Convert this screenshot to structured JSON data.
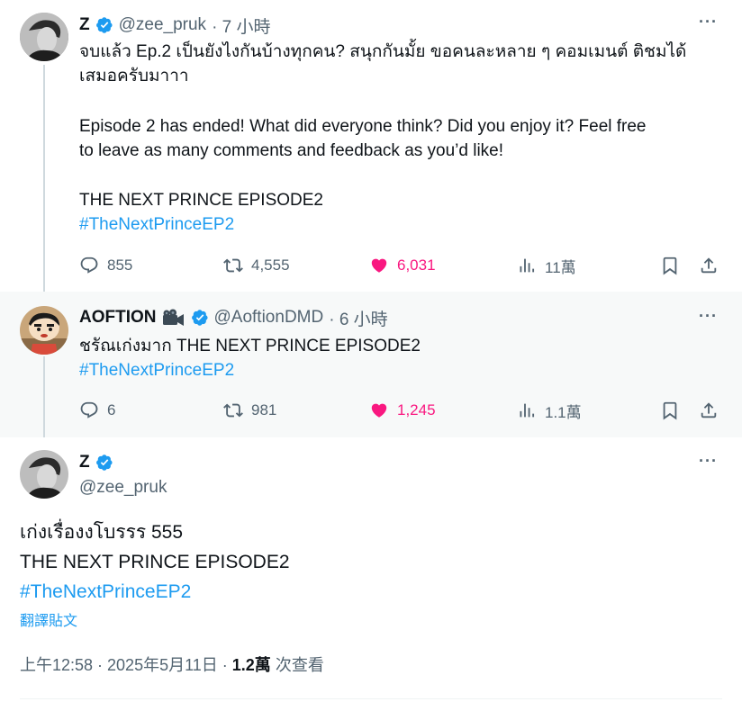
{
  "tweet1": {
    "name": "Z",
    "handle": "@zee_pruk",
    "time": "· 7 小時",
    "text_th": "จบแล้ว Ep.2 เป็นยังไงกันบ้างทุกคน? สนุกกันมั้ย ขอคนละหลาย ๆ คอมเมนต์ ติชมได้\nเสมอครับมาาา",
    "text_en": "Episode 2 has ended! What did everyone think? Did you enjoy it? Feel free\nto leave as many comments and feedback as you’d like!",
    "text_title": "THE NEXT PRINCE EPISODE2",
    "hashtag": "#TheNextPrinceEP2",
    "replies": "855",
    "reposts": "4,555",
    "likes": "6,031",
    "views": "11萬"
  },
  "tweet2": {
    "name": "AOFTION",
    "handle": "@AoftionDMD",
    "time": "· 6 小時",
    "text": "ชรัณเก่งมาก THE NEXT PRINCE EPISODE2",
    "hashtag": "#TheNextPrinceEP2",
    "replies": "6",
    "reposts": "981",
    "likes": "1,245",
    "views": "1.1萬"
  },
  "main": {
    "name": "Z",
    "handle": "@zee_pruk",
    "line1": "เก่งเรื่องงโบรรร 555",
    "line2": "THE NEXT PRINCE EPISODE2",
    "hashtag": "#TheNextPrinceEP2",
    "translate": "翻譯貼文",
    "timestamp": "上午12:58 · 2025年5月11日 · ",
    "views_count": "1.2萬",
    "views_label": " 次查看"
  },
  "colors": {
    "accent": "#1d9bf0",
    "like": "#f91880",
    "muted": "#536471",
    "highlight_bg": "#f7f9f9"
  },
  "icons": [
    "verified-badge-icon",
    "more-icon",
    "reply-icon",
    "repost-icon",
    "like-icon",
    "views-icon",
    "bookmark-icon",
    "share-icon",
    "camera-icon"
  ]
}
